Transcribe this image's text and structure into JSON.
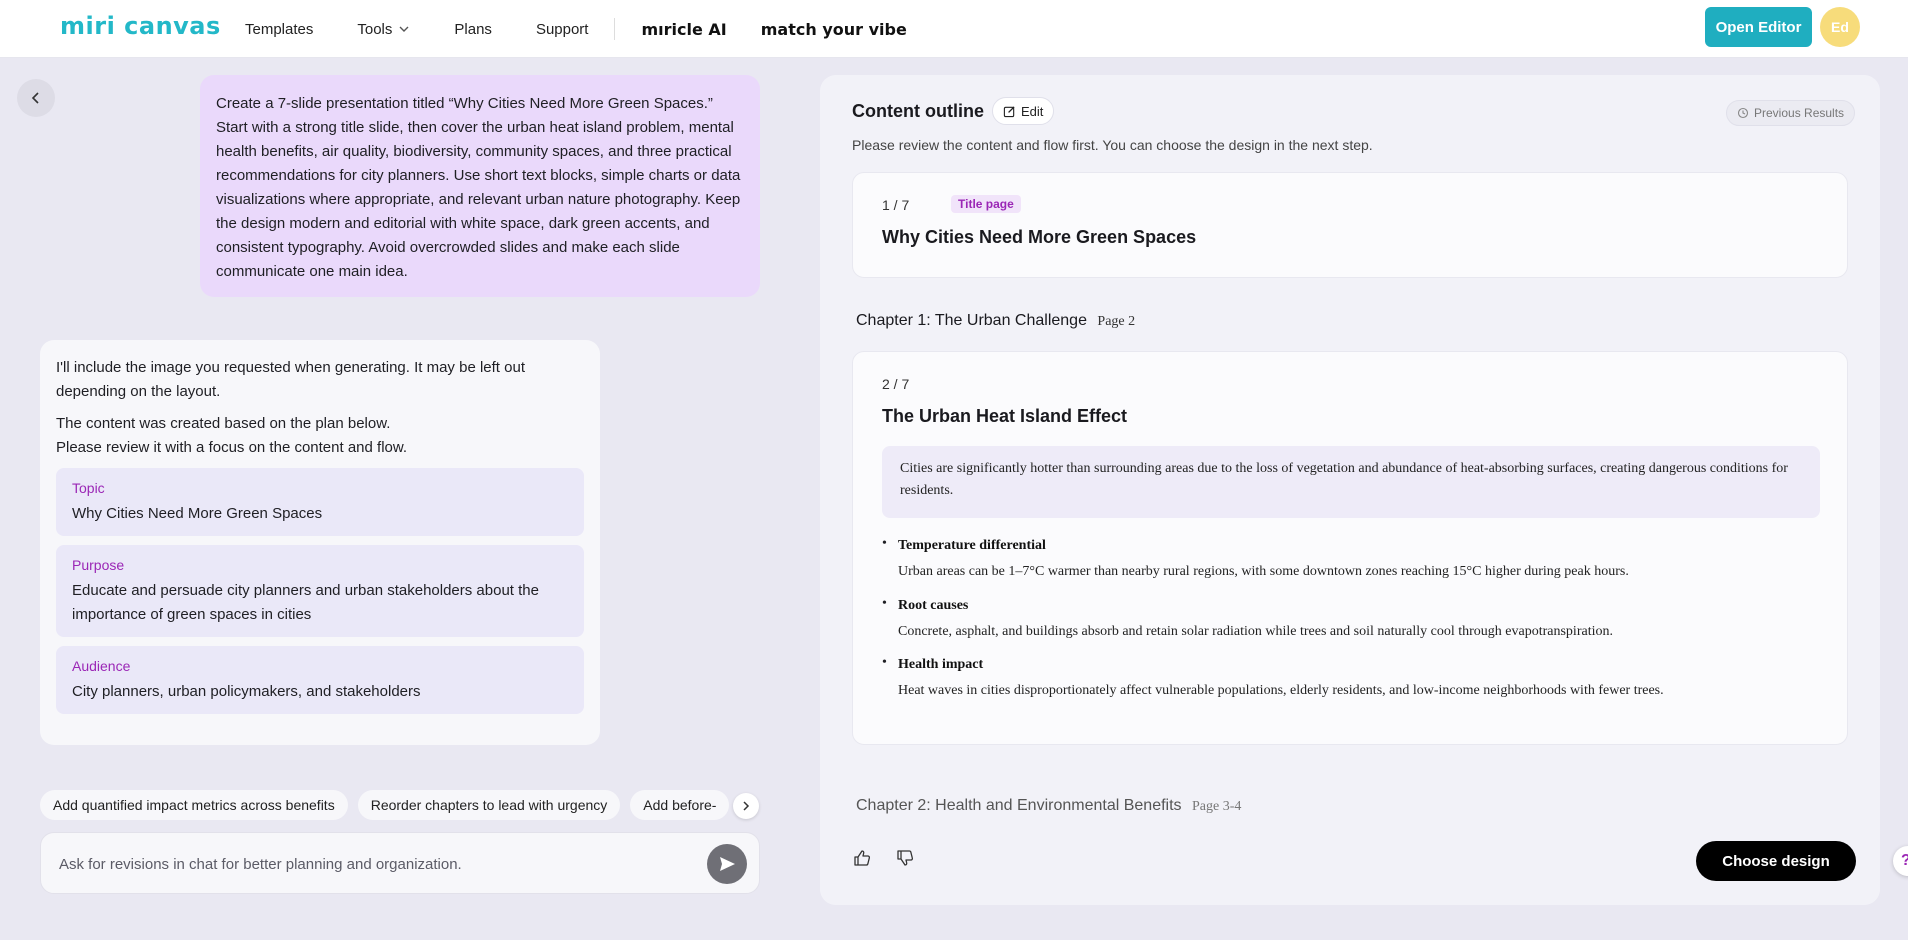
{
  "header": {
    "logo": "miri canvas",
    "nav": [
      {
        "label": "Templates"
      },
      {
        "label": "Tools"
      },
      {
        "label": "Plans"
      },
      {
        "label": "Support"
      }
    ],
    "brand_ai": "mıricle AI",
    "tagline": "match your vibe",
    "open_editor": "Open Editor",
    "avatar": "Ed"
  },
  "chat": {
    "prompt": "Create a 7-slide presentation titled “Why Cities Need More Green Spaces.” Start with a strong title slide, then cover the urban heat island problem, mental health benefits, air quality, biodiversity, community spaces, and three practical recommendations for city planners. Use short text blocks, simple charts or data visualizations where appropriate, and relevant urban nature photography. Keep the design modern and editorial with white space, dark green accents, and consistent typography. Avoid overcrowded slides and make each slide communicate one main idea.",
    "response_line1": "I'll include the image you requested when generating. It may be left out depending on the layout.",
    "response_line2": "The content was created based on the plan below.",
    "response_line3": "Please review it with a focus on the content and flow.",
    "plan": [
      {
        "label": "Topic",
        "value": "Why Cities Need More Green Spaces"
      },
      {
        "label": "Purpose",
        "value": "Educate and persuade city planners and urban stakeholders about the importance of green spaces in cities"
      },
      {
        "label": "Audience",
        "value": "City planners, urban policymakers, and stakeholders"
      }
    ],
    "suggestions": [
      "Add quantified impact metrics across benefits",
      "Reorder chapters to lead with urgency",
      "Add before-"
    ],
    "input_placeholder": "Ask for revisions in chat for better planning and organization."
  },
  "outline": {
    "title": "Content outline",
    "edit": "Edit",
    "previous_results": "Previous Results",
    "subtitle": "Please review the content and flow first. You can choose the design in the next step.",
    "slide1": {
      "num": "1 / 7",
      "badge": "Title page",
      "title": "Why Cities Need More Green Spaces"
    },
    "chapter1": {
      "label": "Chapter 1:",
      "name": "The Urban Challenge",
      "pages": "Page 2"
    },
    "slide2": {
      "num": "2 / 7",
      "title": "The Urban Heat Island Effect",
      "summary": "Cities are significantly hotter than surrounding areas due to the loss of vegetation and abundance of heat-absorbing surfaces, creating dangerous conditions for residents.",
      "bullets": [
        {
          "title": "Temperature differential",
          "body": "Urban areas can be 1–7°C warmer than nearby rural regions, with some downtown zones reaching 15°C higher during peak hours."
        },
        {
          "title": "Root causes",
          "body": "Concrete, asphalt, and buildings absorb and retain solar radiation while trees and soil naturally cool through evapotranspiration."
        },
        {
          "title": "Health impact",
          "body": "Heat waves in cities disproportionately affect vulnerable populations, elderly residents, and low-income neighborhoods with fewer trees."
        }
      ]
    },
    "chapter2": {
      "label": "Chapter 2:",
      "name": "Health and Environmental Benefits",
      "pages": "Page 3-4"
    },
    "choose_design": "Choose design"
  },
  "colors": {
    "brand": "#23b8c8",
    "accent_purple": "#9b27b6",
    "prompt_bg": "#ead9fb"
  }
}
